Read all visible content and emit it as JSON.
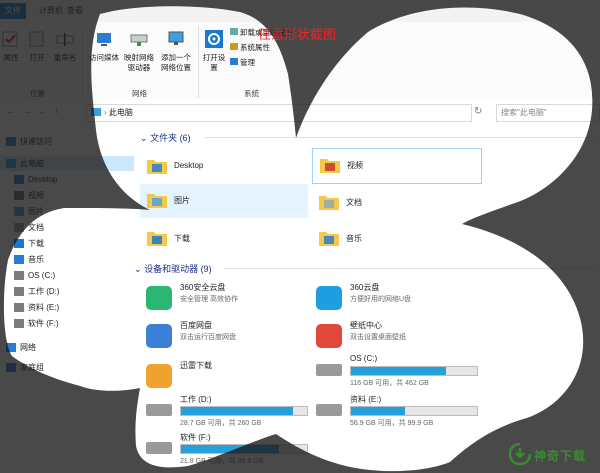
{
  "ribbon_tabs": [
    "文件",
    "计算机",
    "查看"
  ],
  "ribbon": {
    "buttons": [
      {
        "label": "属性"
      },
      {
        "label": "打开"
      },
      {
        "label": "重命名"
      },
      {
        "label": "访问媒体"
      },
      {
        "label": "映射网络驱动器"
      },
      {
        "label": "添加一个网络位置"
      },
      {
        "label": "打开设置"
      }
    ],
    "small_items": [
      "卸载或更改程序",
      "系统属性",
      "管理"
    ],
    "groups": [
      "位置",
      "网络",
      "系统"
    ]
  },
  "screenshot_title": "任意形状截图",
  "address": {
    "path": "此电脑",
    "search_placeholder": "搜索\"此电脑\""
  },
  "nav": [
    {
      "label": "快速访问",
      "icon": "star-icon",
      "indent": false,
      "selected": false
    },
    {
      "label": "此电脑",
      "icon": "computer-icon",
      "indent": false,
      "selected": true
    },
    {
      "label": "Desktop",
      "icon": "desktop-folder-icon",
      "indent": true,
      "selected": false
    },
    {
      "label": "视频",
      "icon": "video-folder-icon",
      "indent": true,
      "selected": false
    },
    {
      "label": "图片",
      "icon": "pictures-folder-icon",
      "indent": true,
      "selected": false
    },
    {
      "label": "文档",
      "icon": "documents-folder-icon",
      "indent": true,
      "selected": false
    },
    {
      "label": "下载",
      "icon": "download-arrow-icon",
      "indent": true,
      "selected": false
    },
    {
      "label": "音乐",
      "icon": "music-note-icon",
      "indent": true,
      "selected": false
    },
    {
      "label": "OS (C:)",
      "icon": "drive-icon",
      "indent": true,
      "selected": false
    },
    {
      "label": "工作 (D:)",
      "icon": "drive-icon",
      "indent": true,
      "selected": false
    },
    {
      "label": "资料 (E:)",
      "icon": "drive-icon",
      "indent": true,
      "selected": false
    },
    {
      "label": "软件 (F:)",
      "icon": "drive-icon",
      "indent": true,
      "selected": false
    },
    {
      "label": "网络",
      "icon": "network-icon",
      "indent": false,
      "selected": false
    },
    {
      "label": "家庭组",
      "icon": "homegroup-icon",
      "indent": false,
      "selected": false
    }
  ],
  "folders_section": {
    "title": "文件夹 (6)"
  },
  "folders": [
    {
      "label": "Desktop",
      "icon": "desktop-folder-icon"
    },
    {
      "label": "视频",
      "icon": "video-folder-icon"
    },
    {
      "label": "图片",
      "icon": "pictures-folder-icon"
    },
    {
      "label": "文档",
      "icon": "documents-folder-icon"
    },
    {
      "label": "下载",
      "icon": "download-folder-icon"
    },
    {
      "label": "音乐",
      "icon": "music-folder-icon"
    }
  ],
  "devices_section": {
    "title": "设备和驱动器 (9)"
  },
  "devices": [
    {
      "name": "360安全云盘",
      "sub": "安全管理 高效协作",
      "icon": "360-secure-cloud-icon"
    },
    {
      "name": "360云盘",
      "sub": "方便好用的网络U盘",
      "icon": "360-cloud-icon"
    },
    {
      "name": "百度网盘",
      "sub": "双击运行百度网盘",
      "icon": "baidu-netdisk-icon"
    },
    {
      "name": "壁纸中心",
      "sub": "双击设置桌面壁纸",
      "icon": "wallpaper-center-icon"
    },
    {
      "name": "迅雷下载",
      "sub": "",
      "icon": "xunlei-icon"
    }
  ],
  "drives": [
    {
      "name": "OS (C:)",
      "free": "116 GB 可用，共 462 GB",
      "used_fraction": 0.75
    },
    {
      "name": "工作 (D:)",
      "free": "28.7 GB 可用，共 260 GB",
      "used_fraction": 0.89
    },
    {
      "name": "资料 (E:)",
      "free": "56.9 GB 可用，共 99.9 GB",
      "used_fraction": 0.43
    },
    {
      "name": "软件 (F:)",
      "free": "21.8 GB 可用，共 99.9 GB",
      "used_fraction": 0.78
    }
  ],
  "watermark": {
    "text": "神奇下载",
    "color": "#3a8a2f"
  },
  "colors": {
    "accent": "#1979ca",
    "bar": "#26a0da",
    "title_red": "#e8262a",
    "shade": "#1b1b1b"
  }
}
